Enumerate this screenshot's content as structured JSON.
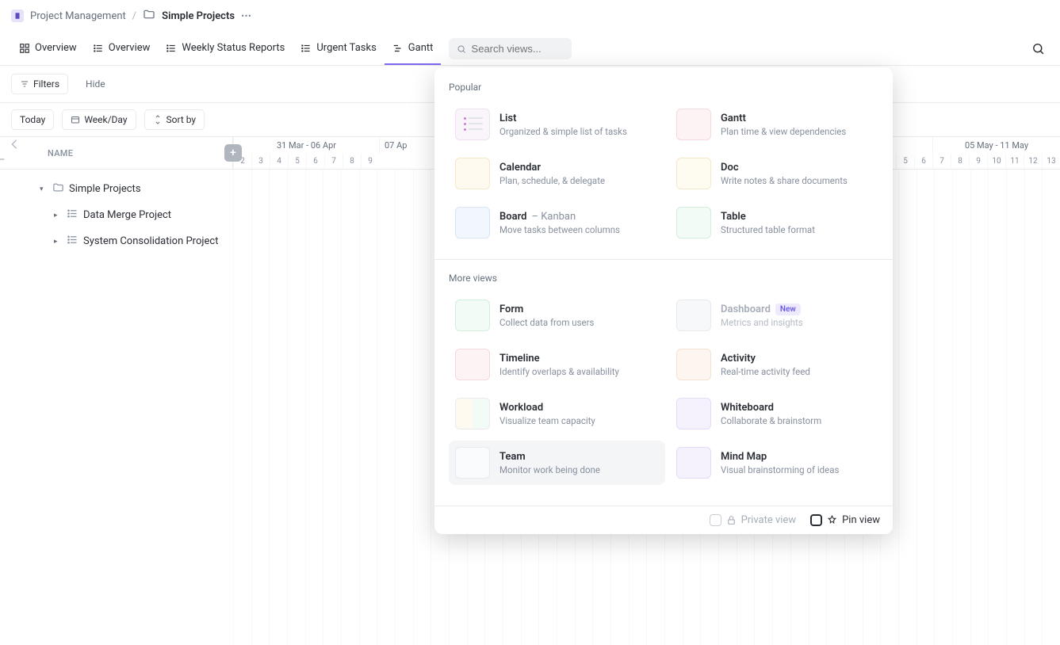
{
  "breadcrumb": {
    "parent": "Project Management",
    "current": "Simple Projects"
  },
  "tabs": [
    {
      "label": "Overview",
      "icon": "dashboard"
    },
    {
      "label": "Overview",
      "icon": "list"
    },
    {
      "label": "Weekly Status Reports",
      "icon": "list"
    },
    {
      "label": "Urgent Tasks",
      "icon": "list"
    },
    {
      "label": "Gantt",
      "icon": "gantt",
      "active": true
    }
  ],
  "search": {
    "placeholder": "Search views..."
  },
  "toolbar": {
    "filters": "Filters",
    "hide": "Hide"
  },
  "gantt": {
    "today": "Today",
    "weekday": "Week/Day",
    "sortby": "Sort by",
    "name_header": "NAME",
    "weeks": [
      {
        "label": "31 Mar - 06 Apr",
        "days": [
          "2",
          "3",
          "4",
          "5",
          "6",
          "7",
          "8",
          "9"
        ]
      },
      {
        "label": "07 Ap",
        "days": []
      },
      {
        "label": "05 May - 11 May",
        "days": [
          "5",
          "6",
          "7",
          "8",
          "9",
          "10",
          "11",
          "12",
          "13"
        ]
      }
    ]
  },
  "tree": {
    "root": "Simple Projects",
    "children": [
      "Data Merge Project",
      "System Consolidation Project"
    ]
  },
  "dropdown": {
    "sections": [
      {
        "title": "Popular",
        "items": [
          {
            "name": "List",
            "desc": "Organized & simple list of tasks",
            "thumb": "th-list"
          },
          {
            "name": "Gantt",
            "desc": "Plan time & view dependencies",
            "thumb": "th-gantt"
          },
          {
            "name": "Calendar",
            "desc": "Plan, schedule, & delegate",
            "thumb": "th-cal"
          },
          {
            "name": "Doc",
            "desc": "Write notes & share documents",
            "thumb": "th-doc"
          },
          {
            "name": "Board",
            "suffix": "– Kanban",
            "desc": "Move tasks between columns",
            "thumb": "th-board"
          },
          {
            "name": "Table",
            "desc": "Structured table format",
            "thumb": "th-table"
          }
        ]
      },
      {
        "title": "More views",
        "items": [
          {
            "name": "Form",
            "desc": "Collect data from users",
            "thumb": "th-form"
          },
          {
            "name": "Dashboard",
            "desc": "Metrics and insights",
            "thumb": "th-dash",
            "badge": "New",
            "dim": true
          },
          {
            "name": "Timeline",
            "desc": "Identify overlaps & availability",
            "thumb": "th-timeline"
          },
          {
            "name": "Activity",
            "desc": "Real-time activity feed",
            "thumb": "th-activity"
          },
          {
            "name": "Workload",
            "desc": "Visualize team capacity",
            "thumb": "th-workload"
          },
          {
            "name": "Whiteboard",
            "desc": "Collaborate & brainstorm",
            "thumb": "th-white"
          },
          {
            "name": "Team",
            "desc": "Monitor work being done",
            "thumb": "th-team",
            "hover": true
          },
          {
            "name": "Mind Map",
            "desc": "Visual brainstorming of ideas",
            "thumb": "th-mind"
          }
        ]
      }
    ],
    "footer": {
      "private": "Private view",
      "pin": "Pin view"
    }
  }
}
